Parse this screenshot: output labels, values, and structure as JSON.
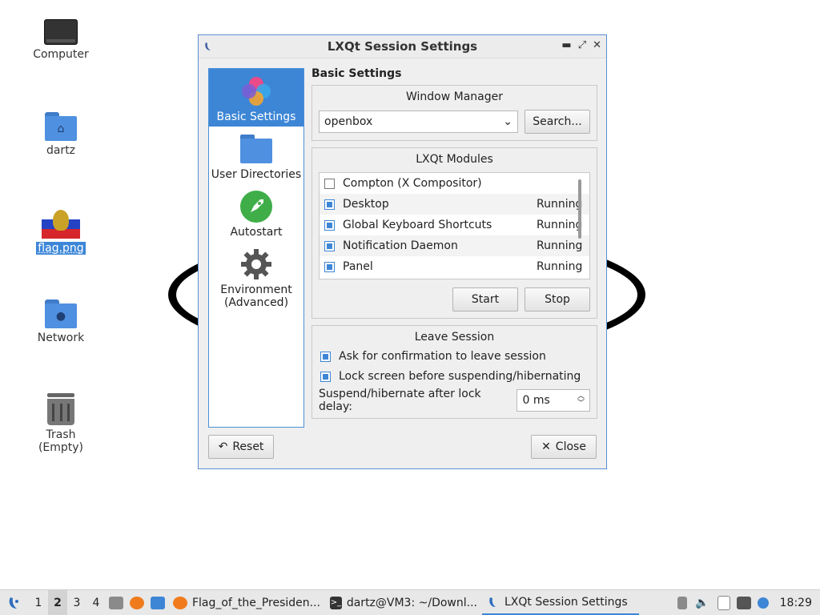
{
  "desktop": {
    "icons": [
      {
        "label": "Computer"
      },
      {
        "label": "dartz"
      },
      {
        "label": "flag.png"
      },
      {
        "label": "Network"
      },
      {
        "label": "Trash (Empty)"
      }
    ]
  },
  "dialog": {
    "title": "LXQt Session Settings",
    "sidebar": [
      {
        "label": "Basic Settings"
      },
      {
        "label": "User Directories"
      },
      {
        "label": "Autostart"
      },
      {
        "label": "Environment\n(Advanced)"
      }
    ],
    "heading": "Basic Settings",
    "window_manager": {
      "title": "Window Manager",
      "value": "openbox",
      "search_label": "Search..."
    },
    "modules": {
      "title": "LXQt Modules",
      "items": [
        {
          "name": "Compton (X Compositor)",
          "checked": false,
          "status": ""
        },
        {
          "name": "Desktop",
          "checked": true,
          "status": "Running"
        },
        {
          "name": "Global Keyboard Shortcuts",
          "checked": true,
          "status": "Running"
        },
        {
          "name": "Notification Daemon",
          "checked": true,
          "status": "Running"
        },
        {
          "name": "Panel",
          "checked": true,
          "status": "Running"
        }
      ],
      "start_label": "Start",
      "stop_label": "Stop"
    },
    "leave": {
      "title": "Leave Session",
      "ask_label": "Ask for confirmation to leave session",
      "ask_checked": true,
      "lock_label": "Lock screen before suspending/hibernating",
      "lock_checked": true,
      "delay_label": "Suspend/hibernate after lock delay:",
      "delay_value": "0 ms"
    },
    "reset_label": "Reset",
    "close_label": "Close"
  },
  "taskbar": {
    "desktops": [
      "1",
      "2",
      "3",
      "4"
    ],
    "current_desktop": "2",
    "tasks": [
      {
        "label": "Flag_of_the_Presiden..."
      },
      {
        "label": "dartz@VM3: ~/Downl..."
      },
      {
        "label": "LXQt Session Settings"
      }
    ],
    "clock": "18:29"
  },
  "colors": {
    "accent": "#3d86d6"
  }
}
